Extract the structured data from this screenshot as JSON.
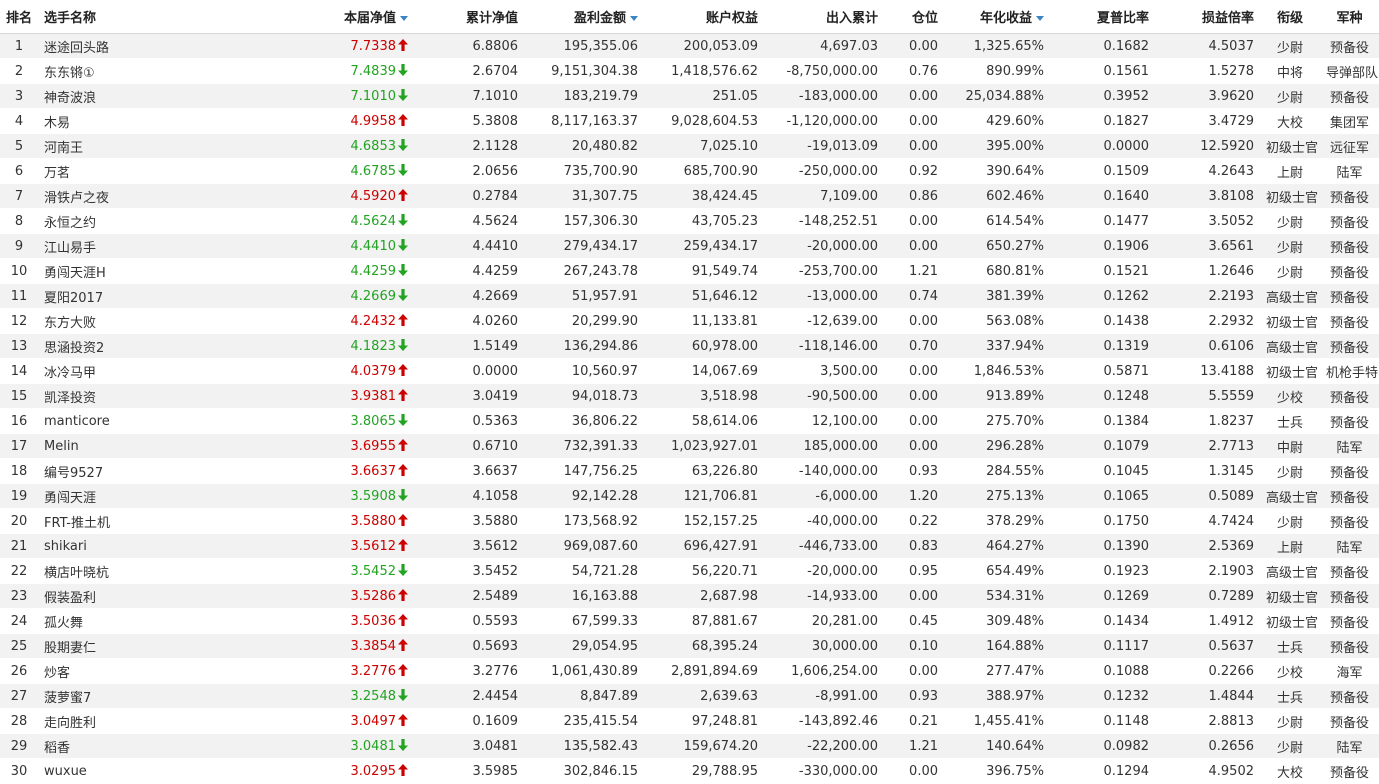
{
  "headers": {
    "rank": "排名",
    "name": "选手名称",
    "nav": "本届净值",
    "cum_nav": "累计净值",
    "profit": "盈利金额",
    "equity": "账户权益",
    "inout": "出入累计",
    "position": "仓位",
    "annual": "年化收益",
    "sharpe": "夏普比率",
    "pl_ratio": "损益倍率",
    "rank_title": "衔级",
    "branch": "军种"
  },
  "colors": {
    "up": "#cc0000",
    "down": "#22a322",
    "sort_indicator": "#3b84c4",
    "row_alt": "#f2f2f2"
  },
  "rows": [
    {
      "rank": "1",
      "name": "迷途回头路",
      "nav": "7.7338",
      "trend": "up",
      "cum_nav": "6.8806",
      "profit": "195,355.06",
      "equity": "200,053.09",
      "inout": "4,697.03",
      "position": "0.00",
      "annual": "1,325.65%",
      "sharpe": "0.1682",
      "pl_ratio": "4.5037",
      "rank_title": "少尉",
      "branch": "预备役"
    },
    {
      "rank": "2",
      "name": "东东锵①",
      "nav": "7.4839",
      "trend": "down",
      "cum_nav": "2.6704",
      "profit": "9,151,304.38",
      "equity": "1,418,576.62",
      "inout": "-8,750,000.00",
      "position": "0.76",
      "annual": "890.99%",
      "sharpe": "0.1561",
      "pl_ratio": "1.5278",
      "rank_title": "中将",
      "branch": "导弹部队"
    },
    {
      "rank": "3",
      "name": "神奇波浪",
      "nav": "7.1010",
      "trend": "down",
      "cum_nav": "7.1010",
      "profit": "183,219.79",
      "equity": "251.05",
      "inout": "-183,000.00",
      "position": "0.00",
      "annual": "25,034.88%",
      "sharpe": "0.3952",
      "pl_ratio": "3.9620",
      "rank_title": "少尉",
      "branch": "预备役"
    },
    {
      "rank": "4",
      "name": "木易",
      "nav": "4.9958",
      "trend": "up",
      "cum_nav": "5.3808",
      "profit": "8,117,163.37",
      "equity": "9,028,604.53",
      "inout": "-1,120,000.00",
      "position": "0.00",
      "annual": "429.60%",
      "sharpe": "0.1827",
      "pl_ratio": "3.4729",
      "rank_title": "大校",
      "branch": "集团军"
    },
    {
      "rank": "5",
      "name": "河南王",
      "nav": "4.6853",
      "trend": "down",
      "cum_nav": "2.1128",
      "profit": "20,480.82",
      "equity": "7,025.10",
      "inout": "-19,013.09",
      "position": "0.00",
      "annual": "395.00%",
      "sharpe": "0.0000",
      "pl_ratio": "12.5920",
      "rank_title": "初级士官",
      "branch": "远征军"
    },
    {
      "rank": "6",
      "name": "万茗",
      "nav": "4.6785",
      "trend": "down",
      "cum_nav": "2.0656",
      "profit": "735,700.90",
      "equity": "685,700.90",
      "inout": "-250,000.00",
      "position": "0.92",
      "annual": "390.64%",
      "sharpe": "0.1509",
      "pl_ratio": "4.2643",
      "rank_title": "上尉",
      "branch": "陆军"
    },
    {
      "rank": "7",
      "name": "滑铁卢之夜",
      "nav": "4.5920",
      "trend": "up",
      "cum_nav": "0.2784",
      "profit": "31,307.75",
      "equity": "38,424.45",
      "inout": "7,109.00",
      "position": "0.86",
      "annual": "602.46%",
      "sharpe": "0.1640",
      "pl_ratio": "3.8108",
      "rank_title": "初级士官",
      "branch": "预备役"
    },
    {
      "rank": "8",
      "name": "永恒之约",
      "nav": "4.5624",
      "trend": "down",
      "cum_nav": "4.5624",
      "profit": "157,306.30",
      "equity": "43,705.23",
      "inout": "-148,252.51",
      "position": "0.00",
      "annual": "614.54%",
      "sharpe": "0.1477",
      "pl_ratio": "3.5052",
      "rank_title": "少尉",
      "branch": "预备役"
    },
    {
      "rank": "9",
      "name": "江山易手",
      "nav": "4.4410",
      "trend": "down",
      "cum_nav": "4.4410",
      "profit": "279,434.17",
      "equity": "259,434.17",
      "inout": "-20,000.00",
      "position": "0.00",
      "annual": "650.27%",
      "sharpe": "0.1906",
      "pl_ratio": "3.6561",
      "rank_title": "少尉",
      "branch": "预备役"
    },
    {
      "rank": "10",
      "name": "勇闯天涯H",
      "nav": "4.4259",
      "trend": "down",
      "cum_nav": "4.4259",
      "profit": "267,243.78",
      "equity": "91,549.74",
      "inout": "-253,700.00",
      "position": "1.21",
      "annual": "680.81%",
      "sharpe": "0.1521",
      "pl_ratio": "1.2646",
      "rank_title": "少尉",
      "branch": "预备役"
    },
    {
      "rank": "11",
      "name": "夏阳2017",
      "nav": "4.2669",
      "trend": "down",
      "cum_nav": "4.2669",
      "profit": "51,957.91",
      "equity": "51,646.12",
      "inout": "-13,000.00",
      "position": "0.74",
      "annual": "381.39%",
      "sharpe": "0.1262",
      "pl_ratio": "2.2193",
      "rank_title": "高级士官",
      "branch": "预备役"
    },
    {
      "rank": "12",
      "name": "东方大败",
      "nav": "4.2432",
      "trend": "up",
      "cum_nav": "4.0260",
      "profit": "20,299.90",
      "equity": "11,133.81",
      "inout": "-12,639.00",
      "position": "0.00",
      "annual": "563.08%",
      "sharpe": "0.1438",
      "pl_ratio": "2.2932",
      "rank_title": "初级士官",
      "branch": "预备役"
    },
    {
      "rank": "13",
      "name": "思涵投资2",
      "nav": "4.1823",
      "trend": "down",
      "cum_nav": "1.5149",
      "profit": "136,294.86",
      "equity": "60,978.00",
      "inout": "-118,146.00",
      "position": "0.70",
      "annual": "337.94%",
      "sharpe": "0.1319",
      "pl_ratio": "0.6106",
      "rank_title": "高级士官",
      "branch": "预备役"
    },
    {
      "rank": "14",
      "name": "冰冷马甲",
      "nav": "4.0379",
      "trend": "up",
      "cum_nav": "0.0000",
      "profit": "10,560.97",
      "equity": "14,067.69",
      "inout": "3,500.00",
      "position": "0.00",
      "annual": "1,846.53%",
      "sharpe": "0.5871",
      "pl_ratio": "13.4188",
      "rank_title": "初级士官",
      "branch": "机枪手特战营"
    },
    {
      "rank": "15",
      "name": "凯泽投资",
      "nav": "3.9381",
      "trend": "up",
      "cum_nav": "3.0419",
      "profit": "94,018.73",
      "equity": "3,518.98",
      "inout": "-90,500.00",
      "position": "0.00",
      "annual": "913.89%",
      "sharpe": "0.1248",
      "pl_ratio": "5.5559",
      "rank_title": "少校",
      "branch": "预备役"
    },
    {
      "rank": "16",
      "name": "manticore",
      "nav": "3.8065",
      "trend": "down",
      "cum_nav": "0.5363",
      "profit": "36,806.22",
      "equity": "58,614.06",
      "inout": "12,100.00",
      "position": "0.00",
      "annual": "275.70%",
      "sharpe": "0.1384",
      "pl_ratio": "1.8237",
      "rank_title": "士兵",
      "branch": "预备役"
    },
    {
      "rank": "17",
      "name": "Melin",
      "nav": "3.6955",
      "trend": "up",
      "cum_nav": "0.6710",
      "profit": "732,391.33",
      "equity": "1,023,927.01",
      "inout": "185,000.00",
      "position": "0.00",
      "annual": "296.28%",
      "sharpe": "0.1079",
      "pl_ratio": "2.7713",
      "rank_title": "中尉",
      "branch": "陆军"
    },
    {
      "rank": "18",
      "name": "编号9527",
      "nav": "3.6637",
      "trend": "up",
      "cum_nav": "3.6637",
      "profit": "147,756.25",
      "equity": "63,226.80",
      "inout": "-140,000.00",
      "position": "0.93",
      "annual": "284.55%",
      "sharpe": "0.1045",
      "pl_ratio": "1.3145",
      "rank_title": "少尉",
      "branch": "预备役"
    },
    {
      "rank": "19",
      "name": "勇闯天涯",
      "nav": "3.5908",
      "trend": "down",
      "cum_nav": "4.1058",
      "profit": "92,142.28",
      "equity": "121,706.81",
      "inout": "-6,000.00",
      "position": "1.20",
      "annual": "275.13%",
      "sharpe": "0.1065",
      "pl_ratio": "0.5089",
      "rank_title": "高级士官",
      "branch": "预备役"
    },
    {
      "rank": "20",
      "name": "FRT-推土机",
      "nav": "3.5880",
      "trend": "up",
      "cum_nav": "3.5880",
      "profit": "173,568.92",
      "equity": "152,157.25",
      "inout": "-40,000.00",
      "position": "0.22",
      "annual": "378.29%",
      "sharpe": "0.1750",
      "pl_ratio": "4.7424",
      "rank_title": "少尉",
      "branch": "预备役"
    },
    {
      "rank": "21",
      "name": "shikari",
      "nav": "3.5612",
      "trend": "up",
      "cum_nav": "3.5612",
      "profit": "969,087.60",
      "equity": "696,427.91",
      "inout": "-446,733.00",
      "position": "0.83",
      "annual": "464.27%",
      "sharpe": "0.1390",
      "pl_ratio": "2.5369",
      "rank_title": "上尉",
      "branch": "陆军"
    },
    {
      "rank": "22",
      "name": "横店叶晓杭",
      "nav": "3.5452",
      "trend": "down",
      "cum_nav": "3.5452",
      "profit": "54,721.28",
      "equity": "56,220.71",
      "inout": "-20,000.00",
      "position": "0.95",
      "annual": "654.49%",
      "sharpe": "0.1923",
      "pl_ratio": "2.1903",
      "rank_title": "高级士官",
      "branch": "预备役"
    },
    {
      "rank": "23",
      "name": "假装盈利",
      "nav": "3.5286",
      "trend": "up",
      "cum_nav": "2.5489",
      "profit": "16,163.88",
      "equity": "2,687.98",
      "inout": "-14,933.00",
      "position": "0.00",
      "annual": "534.31%",
      "sharpe": "0.1269",
      "pl_ratio": "0.7289",
      "rank_title": "初级士官",
      "branch": "预备役"
    },
    {
      "rank": "24",
      "name": "孤火舞",
      "nav": "3.5036",
      "trend": "up",
      "cum_nav": "0.5593",
      "profit": "67,599.33",
      "equity": "87,881.67",
      "inout": "20,281.00",
      "position": "0.45",
      "annual": "309.48%",
      "sharpe": "0.1434",
      "pl_ratio": "1.4912",
      "rank_title": "初级士官",
      "branch": "预备役"
    },
    {
      "rank": "25",
      "name": "股期妻仁",
      "nav": "3.3854",
      "trend": "up",
      "cum_nav": "0.5693",
      "profit": "29,054.95",
      "equity": "68,395.24",
      "inout": "30,000.00",
      "position": "0.10",
      "annual": "164.88%",
      "sharpe": "0.1117",
      "pl_ratio": "0.5637",
      "rank_title": "士兵",
      "branch": "预备役"
    },
    {
      "rank": "26",
      "name": "炒客",
      "nav": "3.2776",
      "trend": "up",
      "cum_nav": "3.2776",
      "profit": "1,061,430.89",
      "equity": "2,891,894.69",
      "inout": "1,606,254.00",
      "position": "0.00",
      "annual": "277.47%",
      "sharpe": "0.1088",
      "pl_ratio": "0.2266",
      "rank_title": "少校",
      "branch": "海军"
    },
    {
      "rank": "27",
      "name": "菠萝蜜7",
      "nav": "3.2548",
      "trend": "down",
      "cum_nav": "2.4454",
      "profit": "8,847.89",
      "equity": "2,639.63",
      "inout": "-8,991.00",
      "position": "0.93",
      "annual": "388.97%",
      "sharpe": "0.1232",
      "pl_ratio": "1.4844",
      "rank_title": "士兵",
      "branch": "预备役"
    },
    {
      "rank": "28",
      "name": "走向胜利",
      "nav": "3.0497",
      "trend": "up",
      "cum_nav": "0.1609",
      "profit": "235,415.54",
      "equity": "97,248.81",
      "inout": "-143,892.46",
      "position": "0.21",
      "annual": "1,455.41%",
      "sharpe": "0.1148",
      "pl_ratio": "2.8813",
      "rank_title": "少尉",
      "branch": "预备役"
    },
    {
      "rank": "29",
      "name": "稻香",
      "nav": "3.0481",
      "trend": "down",
      "cum_nav": "3.0481",
      "profit": "135,582.43",
      "equity": "159,674.20",
      "inout": "-22,200.00",
      "position": "1.21",
      "annual": "140.64%",
      "sharpe": "0.0982",
      "pl_ratio": "0.2656",
      "rank_title": "少尉",
      "branch": "陆军"
    },
    {
      "rank": "30",
      "name": "wuxue",
      "nav": "3.0295",
      "trend": "up",
      "cum_nav": "3.5985",
      "profit": "302,846.15",
      "equity": "29,788.95",
      "inout": "-330,000.00",
      "position": "0.00",
      "annual": "396.75%",
      "sharpe": "0.1294",
      "pl_ratio": "4.9502",
      "rank_title": "大校",
      "branch": "预备役"
    }
  ]
}
